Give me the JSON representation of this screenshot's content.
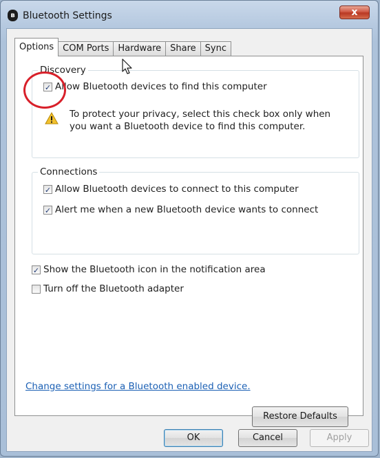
{
  "window": {
    "title": "Bluetooth Settings",
    "close_label": "x",
    "logo_glyph": "ʙ"
  },
  "tabs": [
    {
      "label": "Options",
      "active": true
    },
    {
      "label": "COM Ports",
      "active": false
    },
    {
      "label": "Hardware",
      "active": false
    },
    {
      "label": "Share",
      "active": false
    },
    {
      "label": "Sync",
      "active": false
    }
  ],
  "discovery": {
    "label": "Discovery",
    "allow_find": {
      "label": "Allow Bluetooth devices to find this computer",
      "checked": true
    },
    "warning_line1": "To protect your privacy, select this check box only when",
    "warning_line2": "you want a Bluetooth device to find this computer."
  },
  "connections": {
    "label": "Connections",
    "allow_connect": {
      "label": "Allow Bluetooth devices to connect to this computer",
      "checked": true
    },
    "alert_new": {
      "label": "Alert me when a new Bluetooth device wants to connect",
      "checked": true
    }
  },
  "options": {
    "show_icon": {
      "label": "Show the Bluetooth icon in the notification area",
      "checked": true
    },
    "turn_off": {
      "label": "Turn off the Bluetooth adapter",
      "checked": false
    }
  },
  "link": "Change settings for a Bluetooth enabled device.",
  "buttons": {
    "restore": "Restore Defaults",
    "ok": "OK",
    "cancel": "Cancel",
    "apply": "Apply"
  },
  "checkmark": "✓",
  "colors": {
    "link": "#1a5fb4",
    "highlight_circle": "#d8202a",
    "warning": "#f2c12e"
  }
}
